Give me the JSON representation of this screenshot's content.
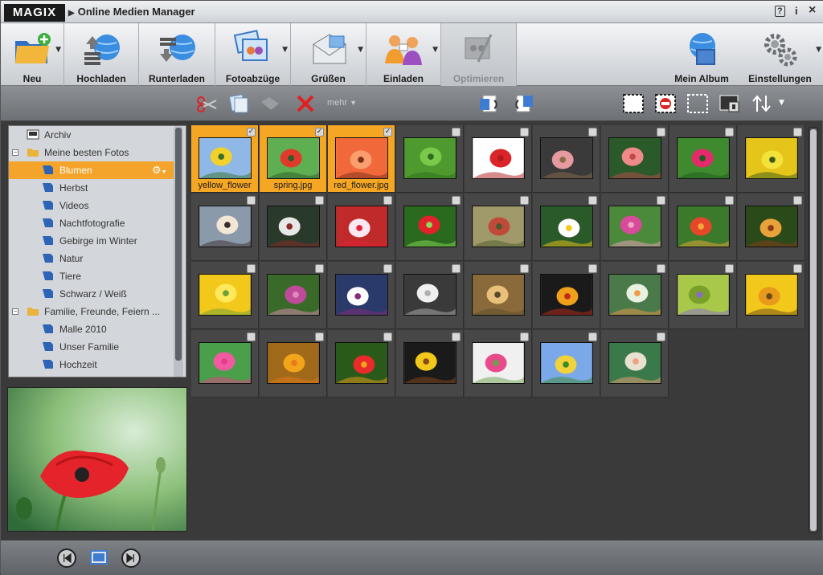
{
  "app": {
    "logo": "MAGIX",
    "title": "Online Medien Manager",
    "help": "?",
    "info": "i",
    "close": "×"
  },
  "toolbar": {
    "neu": "Neu",
    "hochladen": "Hochladen",
    "runterladen": "Runterladen",
    "fotoabzuege": "Fotoabzüge",
    "gruessen": "Grüßen",
    "einladen": "Einladen",
    "optimieren": "Optimieren",
    "mein_album": "Mein Album",
    "einstellungen": "Einstellungen"
  },
  "toolbar2": {
    "mehr": "mehr"
  },
  "tree": {
    "archiv": "Archiv",
    "meine_besten": "Meine besten Fotos",
    "blumen": "Blumen",
    "herbst": "Herbst",
    "videos": "Videos",
    "nacht": "Nachtfotografie",
    "gebirge": "Gebirge im Winter",
    "natur": "Natur",
    "tiere": "Tiere",
    "schwarz": "Schwarz / Weiß",
    "familie": "Familie, Freunde, Feiern ...",
    "malle": "Malle 2010",
    "unser": "Unser Familie",
    "hochzeit": "Hochzeit"
  },
  "grid": {
    "file1": "yellow_flower",
    "file2": "spring.jpg",
    "file3": "red_flower.jpg"
  },
  "colors": {
    "accent": "#f5a623",
    "selected_bg": "#f4a42a"
  }
}
